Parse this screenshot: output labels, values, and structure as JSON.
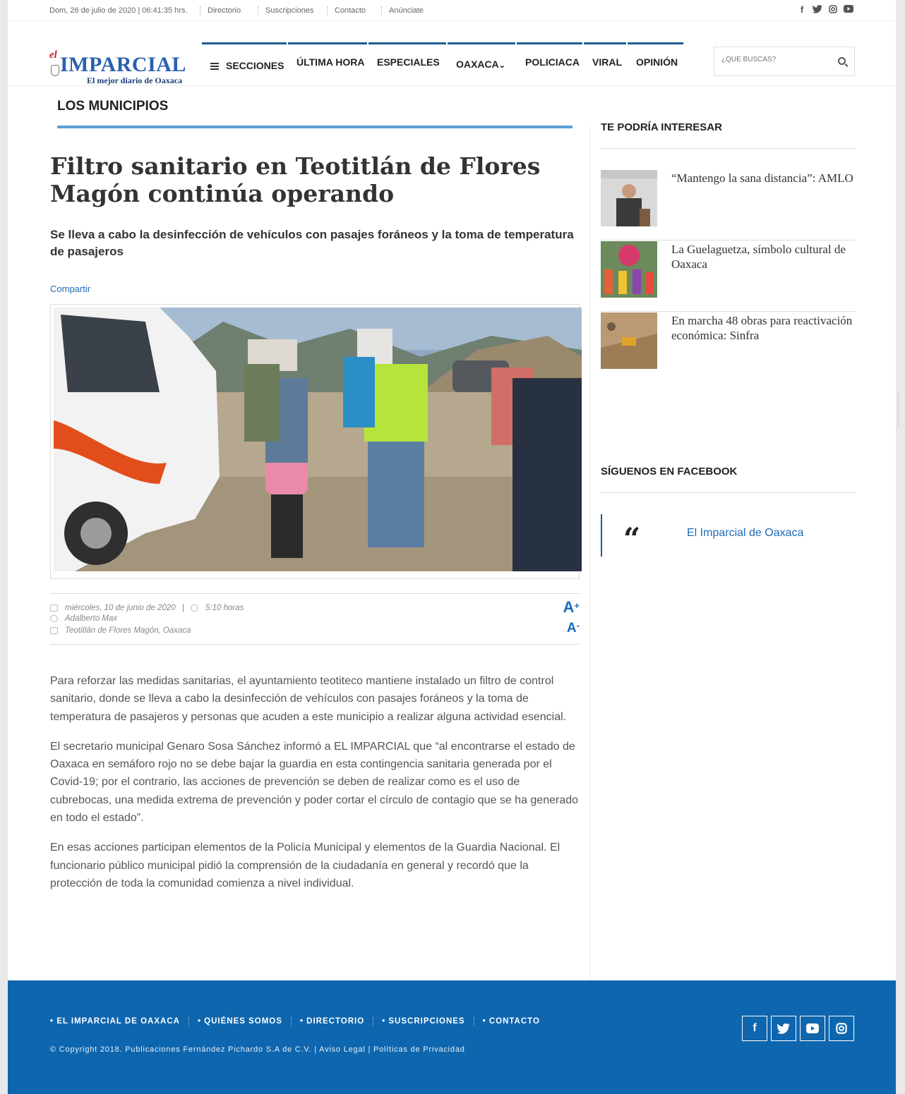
{
  "topbar": {
    "date": "Dom, 26 de julio de 2020 | 06:41:35 hrs.",
    "links": [
      "Directorio",
      "Suscripciones",
      "Contacto",
      "Anúnciate"
    ],
    "social_icons": [
      "facebook-icon",
      "twitter-icon",
      "instagram-icon",
      "youtube-icon"
    ]
  },
  "logo": {
    "prefix": "el",
    "name": "IMPARCIAL",
    "tagline": "El mejor diario de Oaxaca"
  },
  "nav": {
    "sections_label": "SECCIONES",
    "items": [
      "ÚLTIMA HORA",
      "ESPECIALES",
      "OAXACA",
      "POLICIACA",
      "VIRAL",
      "OPINIÓN"
    ],
    "oaxaca_chevron": "⌄",
    "accent": "#1e5b96"
  },
  "search": {
    "placeholder": "¿QUÉ BUSCAS?"
  },
  "section": {
    "title": "LOS MUNICIPIOS",
    "line_color": "#5aa0d6"
  },
  "article": {
    "headline": "Filtro sanitario en Teotitlán de Flores Magón continúa operando",
    "subhead": "Se lleva a cabo la desinfección de vehículos con pasajes foráneos y la toma de temperatura de pasajeros",
    "share_label": "Compartir",
    "date": "miércoles, 10 de junio de 2020",
    "separator": "|",
    "time": "5:10 horas",
    "author": "Adalberto Max",
    "location": "Teotitlán de Flores Magón, Oaxaca",
    "font_increase": "A",
    "font_increase_sign": "+",
    "font_decrease": "A",
    "font_decrease_sign": "-",
    "paragraphs": [
      "Para reforzar las medidas sanitarias, el ayuntamiento teotiteco mantiene instalado un filtro de control sanitario, donde se lleva a cabo la desinfección de vehículos con pasajes foráneos y la toma de temperatura de pasajeros y personas que acuden a este municipio a realizar alguna actividad esencial.",
      "El secretario municipal Genaro Sosa Sánchez informó a EL IMPARCIAL que “al encontrarse el estado de Oaxaca en semáforo rojo no se debe bajar la guardia en esta contingencia sanitaria generada por el Covid-19; por el contrario, las acciones de prevención se deben de realizar como es el uso de cubrebocas, una medida extrema de prevención y poder cortar el círculo de contagio que se ha generado en todo el estado”.",
      "En esas acciones participan elementos de la Policía Municipal y elementos de la Guardia Nacional. El funcionario público municipal pidió la comprensión de la ciudadanía en general y recordó que la protección de toda la comunidad comienza a nivel individual."
    ]
  },
  "sidebar": {
    "related_heading": "TE PODRÍA INTERESAR",
    "related": [
      {
        "title": "“Mantengo la sana distancia”: AMLO"
      },
      {
        "title": "La Guelaguetza, símbolo cultural de Oaxaca"
      },
      {
        "title": "En marcha 48 obras para reactivación económica: Sinfra"
      }
    ],
    "facebook_heading": "SÍGUENOS EN FACEBOOK",
    "facebook_quote": "“",
    "facebook_name": "El Imparcial de Oaxaca"
  },
  "footer": {
    "links": [
      "• EL IMPARCIAL DE OAXACA",
      "• QUIÉNES SOMOS",
      "• DIRECTORIO",
      "• SUSCRIPCIONES",
      "• CONTACTO"
    ],
    "copyright": "© Copyright 2018. Publicaciones Fernández Pichardo S.A de C.V. | Aviso Legal | Políticas de Privacidad",
    "social_icons": [
      "facebook-icon",
      "twitter-icon",
      "youtube-icon",
      "instagram-icon"
    ],
    "background": "#0e66ae"
  }
}
